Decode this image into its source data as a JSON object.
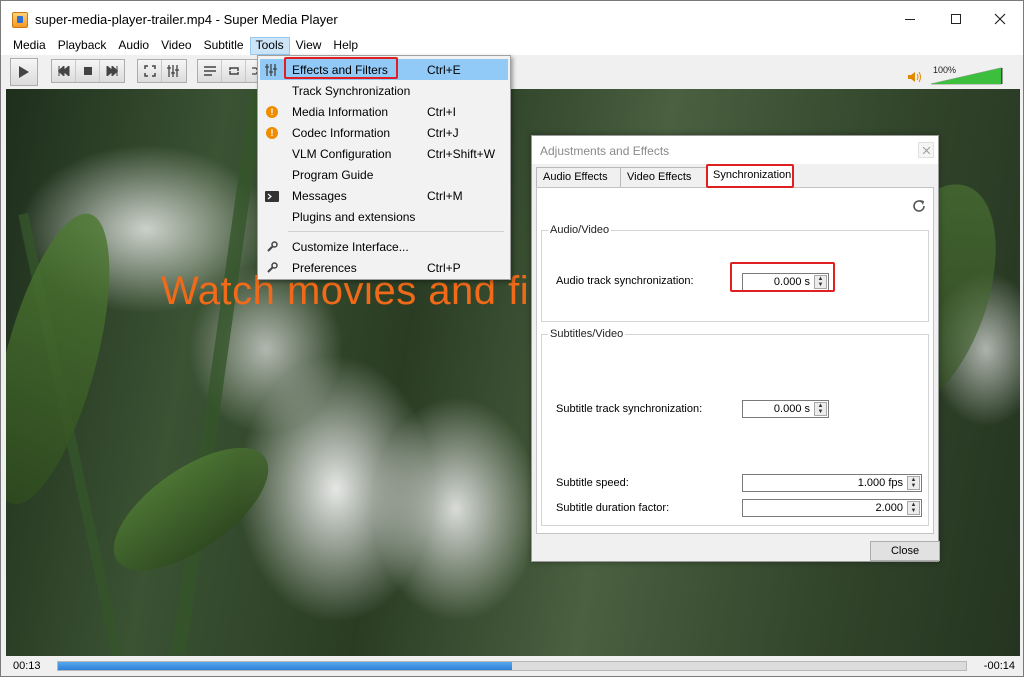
{
  "window": {
    "title": "super-media-player-trailer.mp4 - Super Media Player",
    "controls": {
      "minimize": "minimize-icon",
      "maximize": "maximize-icon",
      "close": "close-icon"
    }
  },
  "menubar": {
    "items": [
      "Media",
      "Playback",
      "Audio",
      "Video",
      "Subtitle",
      "Tools",
      "View",
      "Help"
    ],
    "active": "Tools"
  },
  "toolbar": {
    "buttons": [
      "play-icon",
      "previous-icon",
      "stop-icon",
      "next-icon",
      "fullscreen-icon",
      "extended-settings-icon",
      "playlist-icon",
      "loop-icon",
      "shuffle-icon"
    ],
    "volume_label": "100%",
    "volume_level": 1.0
  },
  "video": {
    "overlay_text": "Watch movies and fil"
  },
  "status": {
    "elapsed": "00:13",
    "remaining": "-00:14",
    "progress": 0.5
  },
  "tools_menu": {
    "items": [
      {
        "label": "Effects and Filters",
        "shortcut": "Ctrl+E",
        "icon": "equalizer-icon",
        "highlighted": true
      },
      {
        "label": "Track Synchronization",
        "shortcut": "",
        "icon": ""
      },
      {
        "label": "Media Information",
        "shortcut": "Ctrl+I",
        "icon": "info-icon"
      },
      {
        "label": "Codec Information",
        "shortcut": "Ctrl+J",
        "icon": "info-icon"
      },
      {
        "label": "VLM Configuration",
        "shortcut": "Ctrl+Shift+W",
        "icon": ""
      },
      {
        "label": "Program Guide",
        "shortcut": "",
        "icon": ""
      },
      {
        "label": "Messages",
        "shortcut": "Ctrl+M",
        "icon": "terminal-icon"
      },
      {
        "label": "Plugins and extensions",
        "shortcut": "",
        "icon": ""
      },
      {
        "label": "Customize Interface...",
        "shortcut": "",
        "icon": "wrench-icon"
      },
      {
        "label": "Preferences",
        "shortcut": "Ctrl+P",
        "icon": "wrench-icon"
      }
    ]
  },
  "dialog": {
    "title": "Adjustments and Effects",
    "tabs": [
      "Audio Effects",
      "Video Effects",
      "Synchronization"
    ],
    "selected_tab": "Synchronization",
    "audio_video": {
      "group_title": "Audio/Video",
      "audio_sync_label": "Audio track synchronization:",
      "audio_sync_value": "0.000 s"
    },
    "subtitles_video": {
      "group_title": "Subtitles/Video",
      "subtitle_sync_label": "Subtitle track synchronization:",
      "subtitle_sync_value": "0.000 s",
      "subtitle_speed_label": "Subtitle speed:",
      "subtitle_speed_value": "1.000 fps",
      "subtitle_duration_label": "Subtitle duration factor:",
      "subtitle_duration_value": "2.000"
    },
    "close_label": "Close"
  },
  "colors": {
    "highlight": "#91c9f7",
    "annotation_red": "#e02020",
    "overlay_orange": "#f06a1a",
    "progress_blue": "#2f7fd6"
  }
}
